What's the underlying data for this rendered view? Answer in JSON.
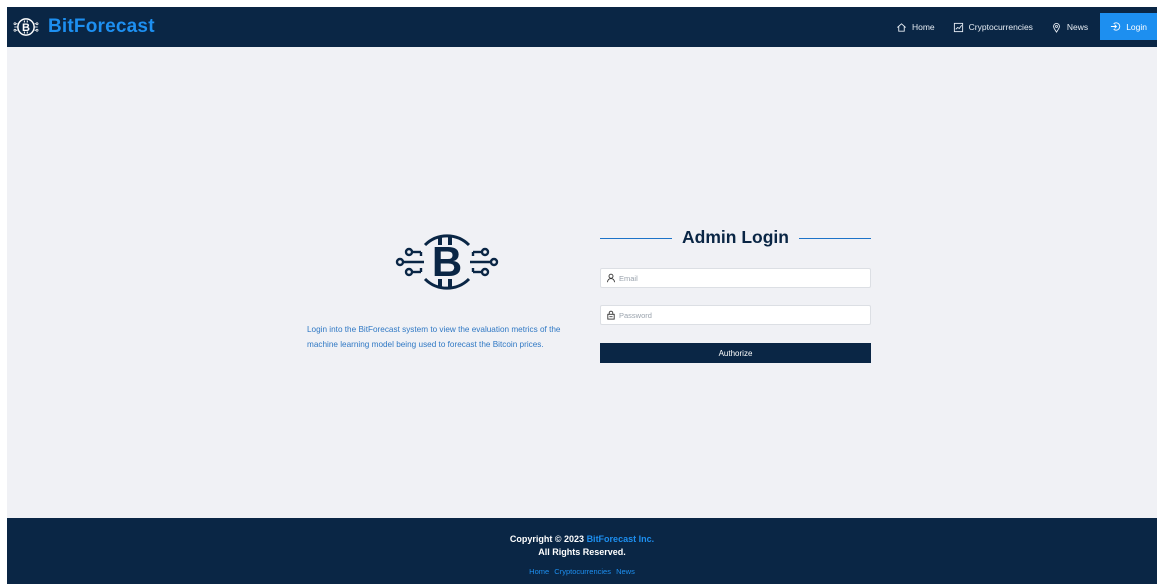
{
  "header": {
    "brand": "BitForecast",
    "nav": [
      {
        "label": "Home",
        "icon": "home-icon"
      },
      {
        "label": "Cryptocurrencies",
        "icon": "chart-icon"
      },
      {
        "label": "News",
        "icon": "map-pin-icon"
      },
      {
        "label": "Login",
        "icon": "login-icon",
        "active": true
      }
    ]
  },
  "main": {
    "tagline_line1": "Login into the BitForecast system to view the evaluation metrics of the",
    "tagline_line2": "machine learning model being used to forecast the Bitcoin prices.",
    "form": {
      "title": "Admin Login",
      "email_placeholder": "Email",
      "password_placeholder": "Password",
      "submit_label": "Authorize"
    }
  },
  "footer": {
    "copyright_prefix": "Copyright © 2023",
    "company": "BitForecast Inc.",
    "rights": "All Rights Reserved.",
    "links": [
      "Home",
      "Cryptocurrencies",
      "News"
    ]
  },
  "colors": {
    "navy": "#0a2645",
    "accent": "#1d8ff0",
    "background": "#f0f1f5"
  }
}
